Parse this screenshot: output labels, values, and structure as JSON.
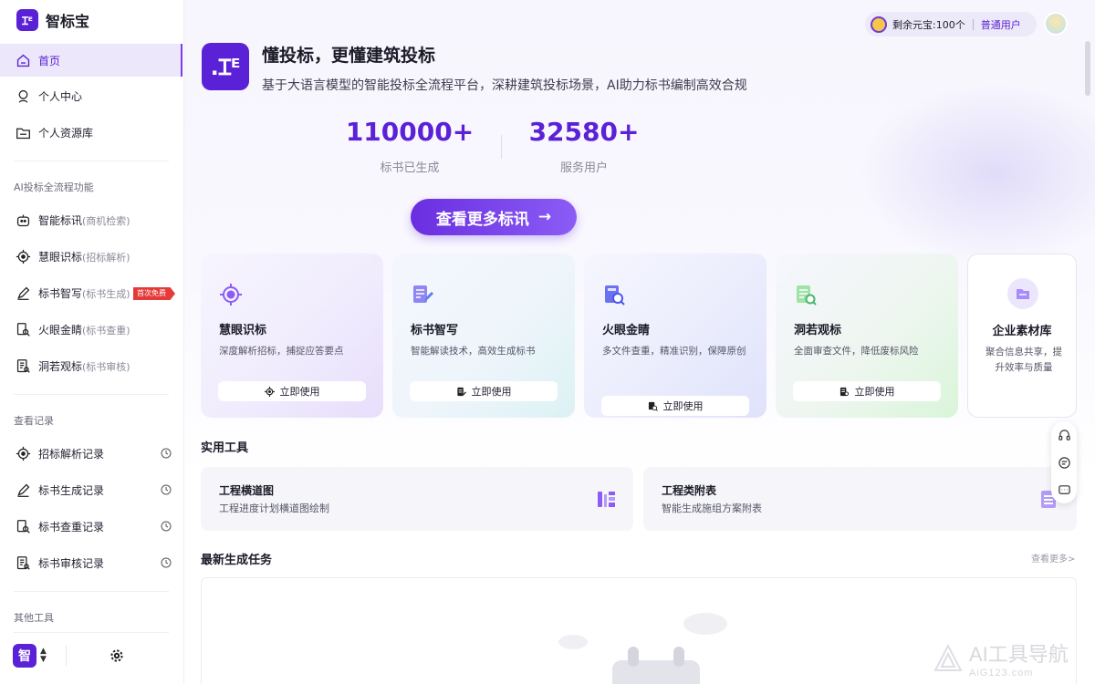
{
  "app": {
    "logo_glyph": "Ɪᴱ",
    "name": "智标宝"
  },
  "sidebar": {
    "nav_top": [
      {
        "label": "首页",
        "icon": "home-icon"
      },
      {
        "label": "个人中心",
        "icon": "user-icon"
      },
      {
        "label": "个人资源库",
        "icon": "folder-icon"
      }
    ],
    "section_ai": "AI投标全流程功能",
    "ai_items": [
      {
        "label": "智能标讯",
        "sub": "(商机检索)",
        "icon": "bot-icon"
      },
      {
        "label": "慧眼识标",
        "sub": "(招标解析)",
        "icon": "target-icon"
      },
      {
        "label": "标书智写",
        "sub": "(标书生成)",
        "icon": "pen-icon"
      },
      {
        "label": "火眼金睛",
        "sub": "(标书查重)",
        "icon": "doc-search-icon"
      },
      {
        "label": "洞若观标",
        "sub": "(标书审核)",
        "icon": "doc-review-icon"
      }
    ],
    "free_badge": "首次免费",
    "section_history": "查看记录",
    "history_items": [
      {
        "label": "招标解析记录",
        "icon": "target-icon"
      },
      {
        "label": "标书生成记录",
        "icon": "pen-icon"
      },
      {
        "label": "标书查重记录",
        "icon": "doc-search-icon"
      },
      {
        "label": "标书审核记录",
        "icon": "doc-review-icon"
      }
    ],
    "section_other": "其他工具",
    "bottom_zhi": "智"
  },
  "topbar": {
    "balance_label": "剩余元宝:",
    "balance_value": "100个",
    "user_level": "普通用户"
  },
  "hero": {
    "logo_glyph": ".Ɪᴱ",
    "title": "懂投标，更懂建筑投标",
    "subtitle": "基于大语言模型的智能投标全流程平台，深耕建筑投标场景，AI助力标书编制高效合规",
    "stats": [
      {
        "value": "110000+",
        "label": "标书已生成"
      },
      {
        "value": "32580+",
        "label": "服务用户"
      }
    ],
    "cta_label": "查看更多标讯",
    "cta_arrow": "→"
  },
  "feature_cards": [
    {
      "title": "慧眼识标",
      "desc": "深度解析招标，捕捉应答要点",
      "button": "立即使用",
      "icon": "target-icon",
      "color": "#8b5cf6"
    },
    {
      "title": "标书智写",
      "desc": "智能解读技术，高效生成标书",
      "button": "立即使用",
      "icon": "doc-write-icon",
      "color": "#7c6cf0"
    },
    {
      "title": "火眼金睛",
      "desc": "多文件查重，精准识别，保障原创",
      "button": "立即使用",
      "icon": "doc-search-icon",
      "color": "#6a72f0"
    },
    {
      "title": "洞若观标",
      "desc": "全面审查文件，降低废标风险",
      "button": "立即使用",
      "icon": "doc-review-icon",
      "color": "#9a7df3"
    },
    {
      "title": "企业素材库",
      "desc": "聚合信息共享，提升效率与质量",
      "icon": "folder-icon",
      "color": "#a78bfa"
    }
  ],
  "tools_section": {
    "title": "实用工具",
    "items": [
      {
        "title": "工程横道图",
        "desc": "工程进度计划横道图绘制",
        "icon": "gantt-icon"
      },
      {
        "title": "工程类附表",
        "desc": "智能生成施组方案附表",
        "icon": "table-icon"
      }
    ]
  },
  "tasks_section": {
    "title": "最新生成任务",
    "more": "查看更多>"
  },
  "watermark": {
    "line1": "AI工具导航",
    "line2": "AiG123.com"
  }
}
